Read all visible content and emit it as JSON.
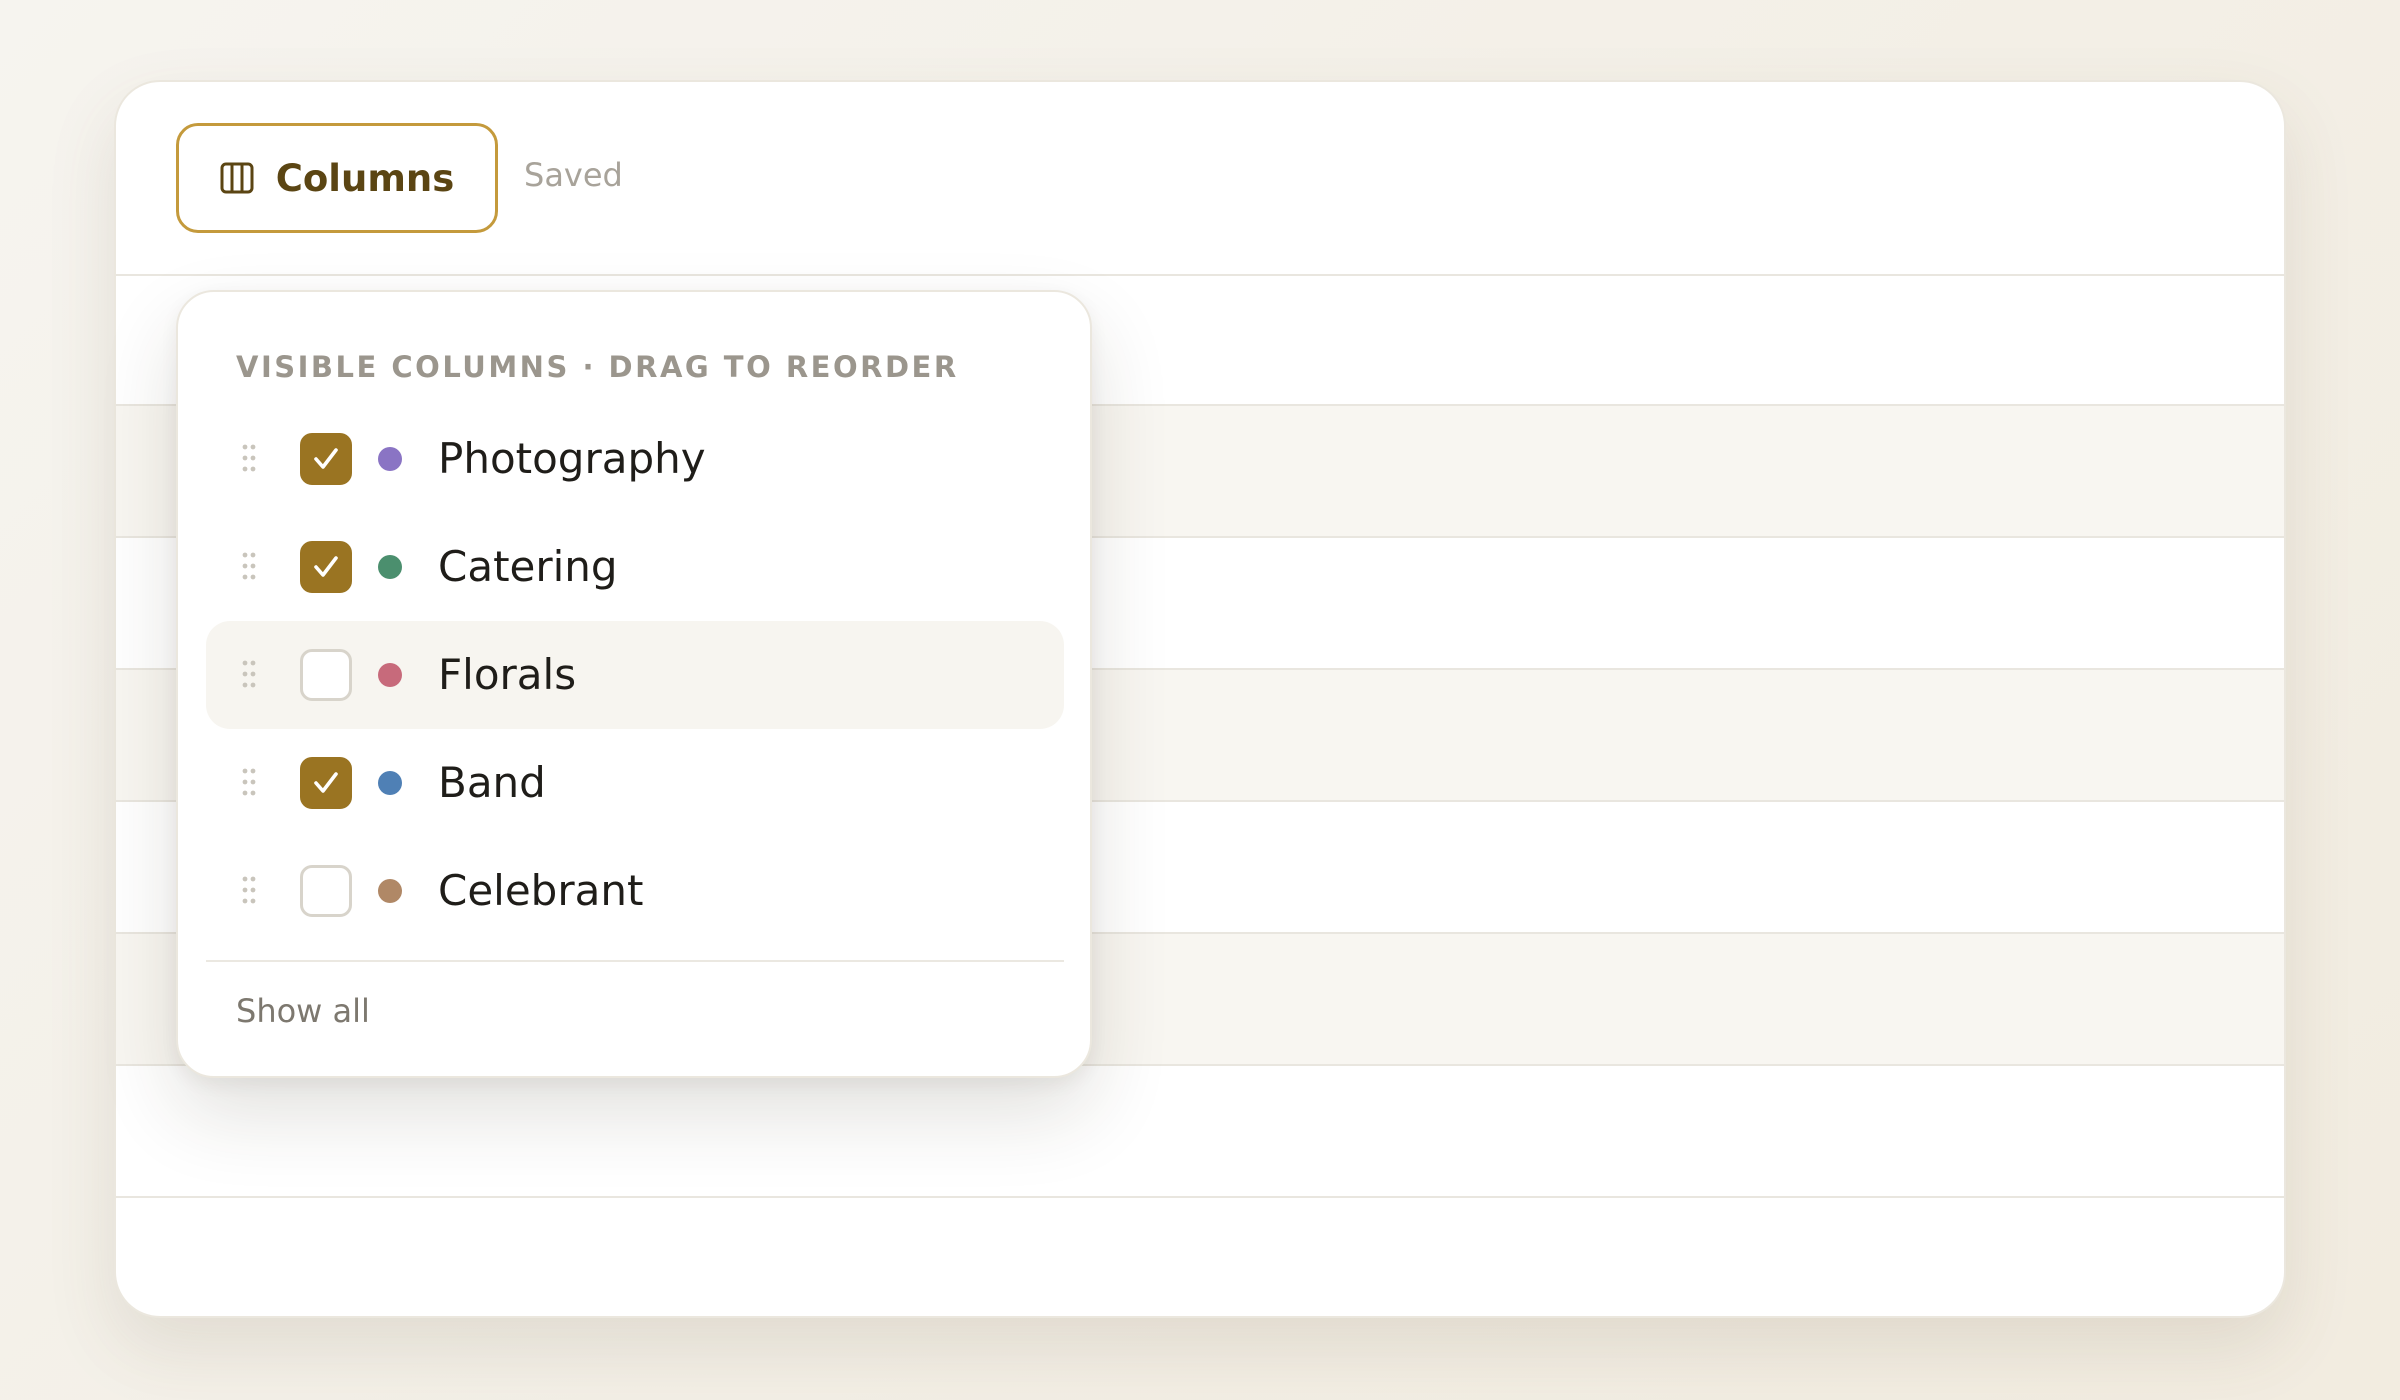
{
  "toolbar": {
    "columns_button_label": "Columns",
    "status_text": "Saved"
  },
  "popover": {
    "heading": "VISIBLE COLUMNS · DRAG TO REORDER",
    "options": [
      {
        "label": "Photography",
        "checked": true,
        "color": "#8a74c4"
      },
      {
        "label": "Catering",
        "checked": true,
        "color": "#4b8f6e"
      },
      {
        "label": "Florals",
        "checked": false,
        "color": "#c76a7b"
      },
      {
        "label": "Band",
        "checked": true,
        "color": "#4f80b5"
      },
      {
        "label": "Celebrant",
        "checked": false,
        "color": "#b08866"
      }
    ],
    "show_all_label": "Show all"
  },
  "colors": {
    "accent": "#9a7422",
    "accent_border": "#c49a3c",
    "accent_text": "#5b4513"
  }
}
